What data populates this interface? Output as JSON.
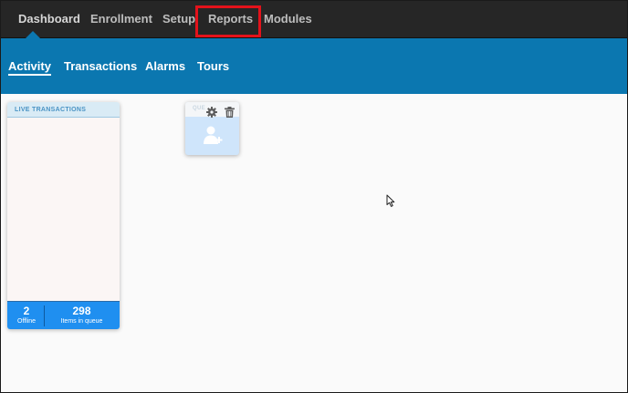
{
  "topnav": {
    "items": [
      {
        "label": "Dashboard"
      },
      {
        "label": "Enrollment"
      },
      {
        "label": "Setup"
      },
      {
        "label": "Reports"
      },
      {
        "label": "Modules"
      }
    ],
    "active": "Dashboard",
    "highlighted": "Reports",
    "highlight_color": "#e3121b"
  },
  "subnav": {
    "items": [
      {
        "label": "Activity"
      },
      {
        "label": "Transactions"
      },
      {
        "label": "Alarms"
      },
      {
        "label": "Tours"
      }
    ],
    "active": "Activity",
    "color": "#0b77b0"
  },
  "live_widget": {
    "title": "LIVE TRANSACTIONS",
    "stats": [
      {
        "value": "2",
        "label": "Offline"
      },
      {
        "value": "298",
        "label": "Items in queue"
      }
    ]
  },
  "queue_widget": {
    "title": "QUE",
    "icons": [
      "gear-icon",
      "trash-icon",
      "add-user-icon"
    ]
  }
}
